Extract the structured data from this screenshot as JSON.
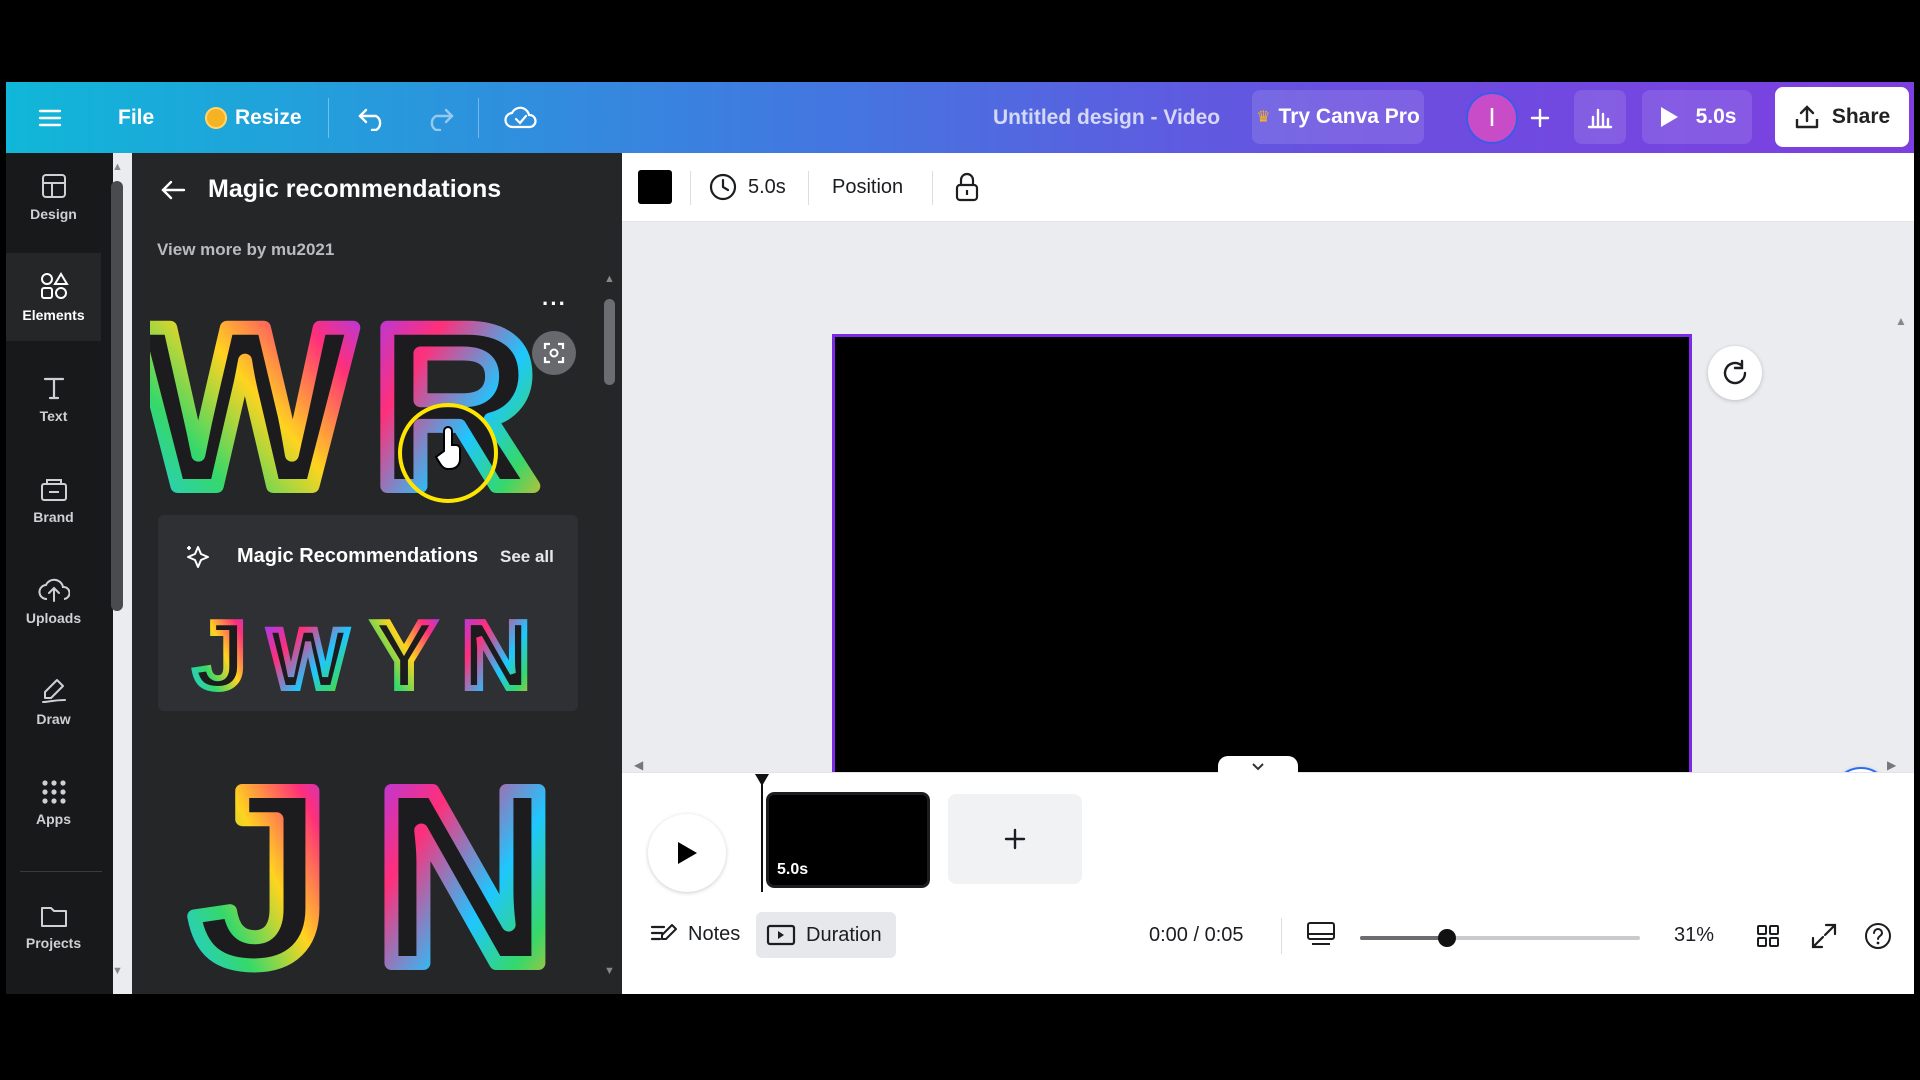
{
  "topbar": {
    "file_label": "File",
    "resize_label": "Resize",
    "title": "Untitled design - Video",
    "try_pro_label": "Try Canva Pro",
    "avatar_letter": "I",
    "play_duration": "5.0s",
    "share_label": "Share",
    "brand_gradient": [
      "#10b7d8",
      "#3f7be0",
      "#7d3fe0"
    ]
  },
  "rail": {
    "items": [
      {
        "label": "Design",
        "icon": "layout-icon"
      },
      {
        "label": "Elements",
        "icon": "shapes-icon"
      },
      {
        "label": "Text",
        "icon": "text-icon"
      },
      {
        "label": "Brand",
        "icon": "brand-icon"
      },
      {
        "label": "Uploads",
        "icon": "cloud-upload-icon"
      },
      {
        "label": "Draw",
        "icon": "pen-icon"
      },
      {
        "label": "Apps",
        "icon": "grid-icon"
      },
      {
        "label": "Projects",
        "icon": "folder-icon"
      }
    ],
    "active": "Elements"
  },
  "panel": {
    "title": "Magic recommendations",
    "view_more": "View more by mu2021",
    "magic_section_title": "Magic Recommendations",
    "see_all": "See all",
    "top_letters": [
      "W",
      "R"
    ],
    "small_letters": [
      "J",
      "W",
      "Y",
      "N"
    ],
    "big_letters": [
      "J",
      "N"
    ]
  },
  "toolbar": {
    "color_swatch": "#000000",
    "duration": "5.0s",
    "position_label": "Position"
  },
  "canvas": {
    "background": "#000000",
    "border_color": "#7d2ae8"
  },
  "timeline": {
    "clip_duration": "5.0s",
    "notes_label": "Notes",
    "duration_label": "Duration",
    "time": "0:00 / 0:05",
    "zoom": "31%",
    "zoom_fraction": 0.31
  }
}
